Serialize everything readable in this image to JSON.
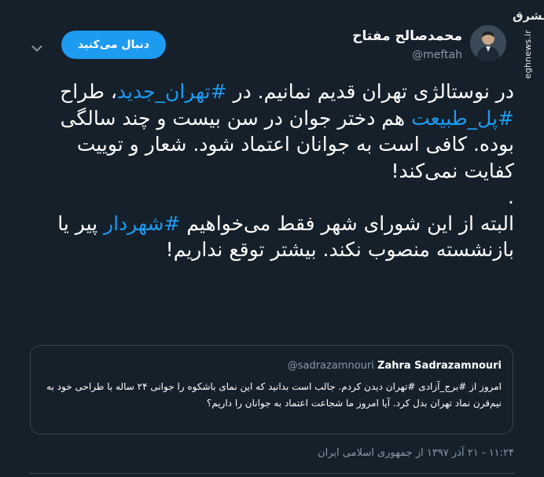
{
  "watermark": {
    "logo_text": "مشرق",
    "url": "mashreghnews.ir"
  },
  "author": {
    "name": "محمدصالح مفتاح",
    "handle": "@meftah"
  },
  "follow_button": {
    "label": "دنبال می‌کنید"
  },
  "icons": {
    "chevron": "chevron-down-icon",
    "avatar": "avatar"
  },
  "tweet": {
    "p1": [
      {
        "text": "در نوستالژی تهران قدیم نمانیم. در "
      },
      {
        "text": "#تهران_جدید",
        "tag": true
      },
      {
        "text": "، طراح "
      },
      {
        "text": "#پل_طبیعت",
        "tag": true
      },
      {
        "text": " هم دختر جوان در سن بیست و چند سالگی بوده. کافی است به جوانان اعتماد شود. شعار و توییت کفایت نمی‌کند!"
      }
    ],
    "dot": ".",
    "p2": [
      {
        "text": "البته از این شورای شهر فقط می‌خواهیم "
      },
      {
        "text": "#شهردار",
        "tag": true
      },
      {
        "text": " پیر یا بازنشسته منصوب نکند. بیشتر توقع نداریم!"
      }
    ]
  },
  "quote": {
    "name": "Zahra Sadrazamnouri",
    "handle": "@sadrazamnouri",
    "text": "امروز از #برج_آزادی #تهران دیدن کردم. جالب است بدانید که این نمای باشکوه را جوانی ۲۴ ساله با طراحی خود به نیم‌قرن نماد تهران بدل کرد. آیا امروز ما شجاعت اعتماد به جوانان را داریم؟"
  },
  "meta": {
    "time": "۱۱:۲۴",
    "date": "۲۱ آذر ۱۳۹۷",
    "from": "از",
    "location": "جمهوری اسلامی ایران"
  },
  "colors": {
    "background": "#15202b",
    "accent": "#1d9bf0",
    "muted": "#8899a6",
    "border": "#38444d"
  }
}
